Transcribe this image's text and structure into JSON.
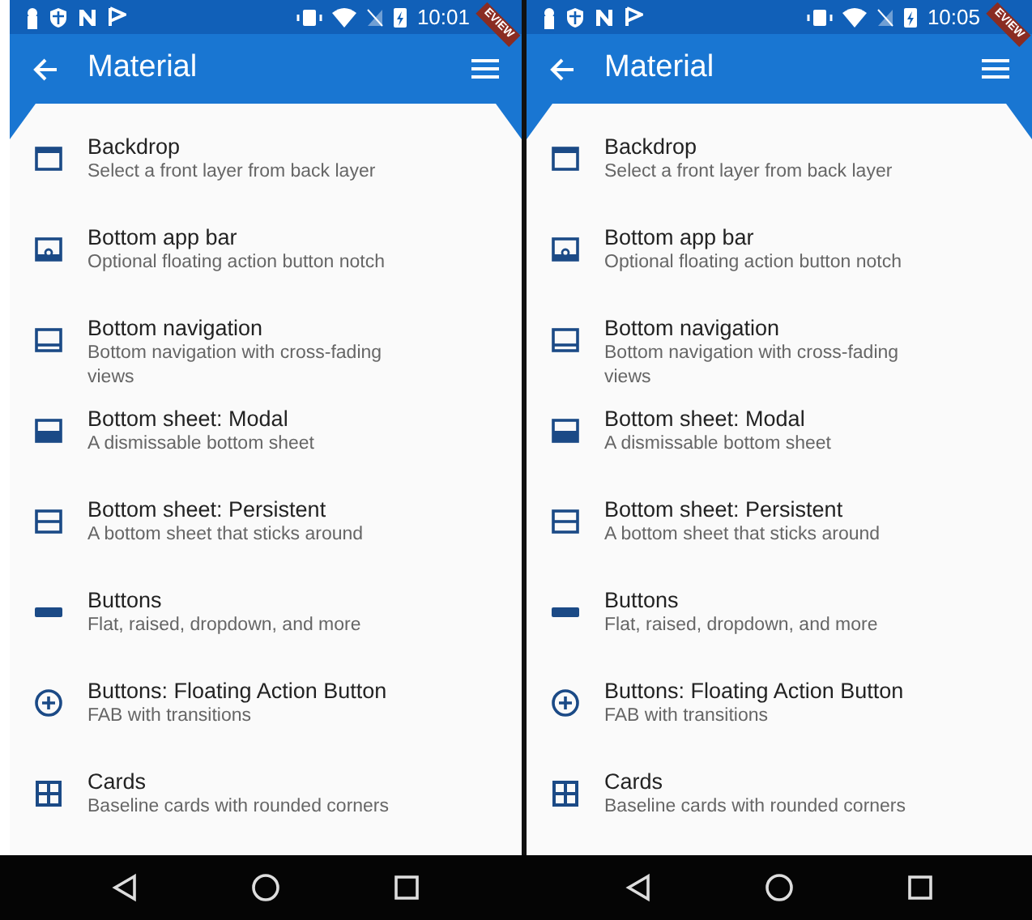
{
  "phones": [
    {
      "status_time": "10:01",
      "banner": "EVIEW",
      "title": "Material",
      "items": [
        {
          "kind": "backdrop",
          "title": "Backdrop",
          "subtitle": "Select a front layer from back layer"
        },
        {
          "kind": "app_bar",
          "title": "Bottom app bar",
          "subtitle": "Optional floating action button notch"
        },
        {
          "kind": "navigation",
          "title": "Bottom navigation",
          "subtitle": "Bottom navigation with cross-fading views"
        },
        {
          "kind": "sheet_modal",
          "title": "Bottom sheet: Modal",
          "subtitle": "A dismissable bottom sheet"
        },
        {
          "kind": "sheet_persistent",
          "title": "Bottom sheet: Persistent",
          "subtitle": "A bottom sheet that sticks around"
        },
        {
          "kind": "buttons",
          "title": "Buttons",
          "subtitle": "Flat, raised, dropdown, and more"
        },
        {
          "kind": "fab",
          "title": "Buttons: Floating Action Button",
          "subtitle": "FAB with transitions"
        },
        {
          "kind": "cards",
          "title": "Cards",
          "subtitle": "Baseline cards with rounded corners"
        }
      ]
    },
    {
      "status_time": "10:05",
      "banner": "EVIEW",
      "title": "Material",
      "items": [
        {
          "kind": "backdrop",
          "title": "Backdrop",
          "subtitle": "Select a front layer from back layer"
        },
        {
          "kind": "app_bar",
          "title": "Bottom app bar",
          "subtitle": "Optional floating action button notch"
        },
        {
          "kind": "navigation",
          "title": "Bottom navigation",
          "subtitle": "Bottom navigation with cross-fading views"
        },
        {
          "kind": "sheet_modal",
          "title": "Bottom sheet: Modal",
          "subtitle": "A dismissable bottom sheet"
        },
        {
          "kind": "sheet_persistent",
          "title": "Bottom sheet: Persistent",
          "subtitle": "A bottom sheet that sticks around"
        },
        {
          "kind": "buttons",
          "title": "Buttons",
          "subtitle": "Flat, raised, dropdown, and more"
        },
        {
          "kind": "fab",
          "title": "Buttons: Floating Action Button",
          "subtitle": "FAB with transitions"
        },
        {
          "kind": "cards",
          "title": "Cards",
          "subtitle": "Baseline cards with rounded corners"
        }
      ]
    }
  ]
}
